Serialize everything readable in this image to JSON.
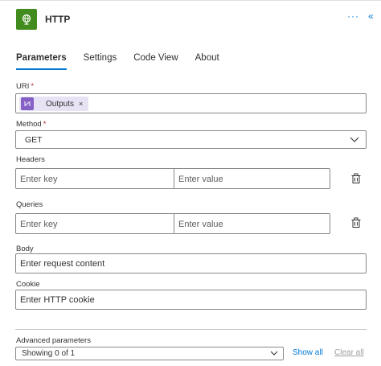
{
  "header": {
    "title": "HTTP",
    "more_label": "···",
    "collapse_label": "«",
    "icon": "globe-icon",
    "icon_color": "#428c1f"
  },
  "tabs": [
    {
      "label": "Parameters",
      "active": true
    },
    {
      "label": "Settings",
      "active": false
    },
    {
      "label": "Code View",
      "active": false
    },
    {
      "label": "About",
      "active": false
    }
  ],
  "uri": {
    "label": "URI",
    "required_mark": "*",
    "token": {
      "label": "Outputs",
      "close": "×",
      "icon": "expression-icon",
      "color": "#8661c5"
    }
  },
  "method": {
    "label": "Method",
    "required_mark": "*",
    "value": "GET"
  },
  "headers": {
    "label": "Headers",
    "key_placeholder": "Enter key",
    "value_placeholder": "Enter value",
    "delete_icon": "delete-icon"
  },
  "queries": {
    "label": "Queries",
    "key_placeholder": "Enter key",
    "value_placeholder": "Enter value",
    "delete_icon": "delete-icon"
  },
  "body": {
    "label": "Body",
    "placeholder": "Enter request content"
  },
  "cookie": {
    "label": "Cookie",
    "placeholder": "Enter HTTP cookie"
  },
  "advanced": {
    "label": "Advanced parameters",
    "value": "Showing 0 of 1",
    "show_all": "Show all",
    "clear_all": "Clear all"
  },
  "colors": {
    "accent": "#0078d4",
    "required": "#a4262c",
    "disabled_link": "#a19f9d"
  }
}
